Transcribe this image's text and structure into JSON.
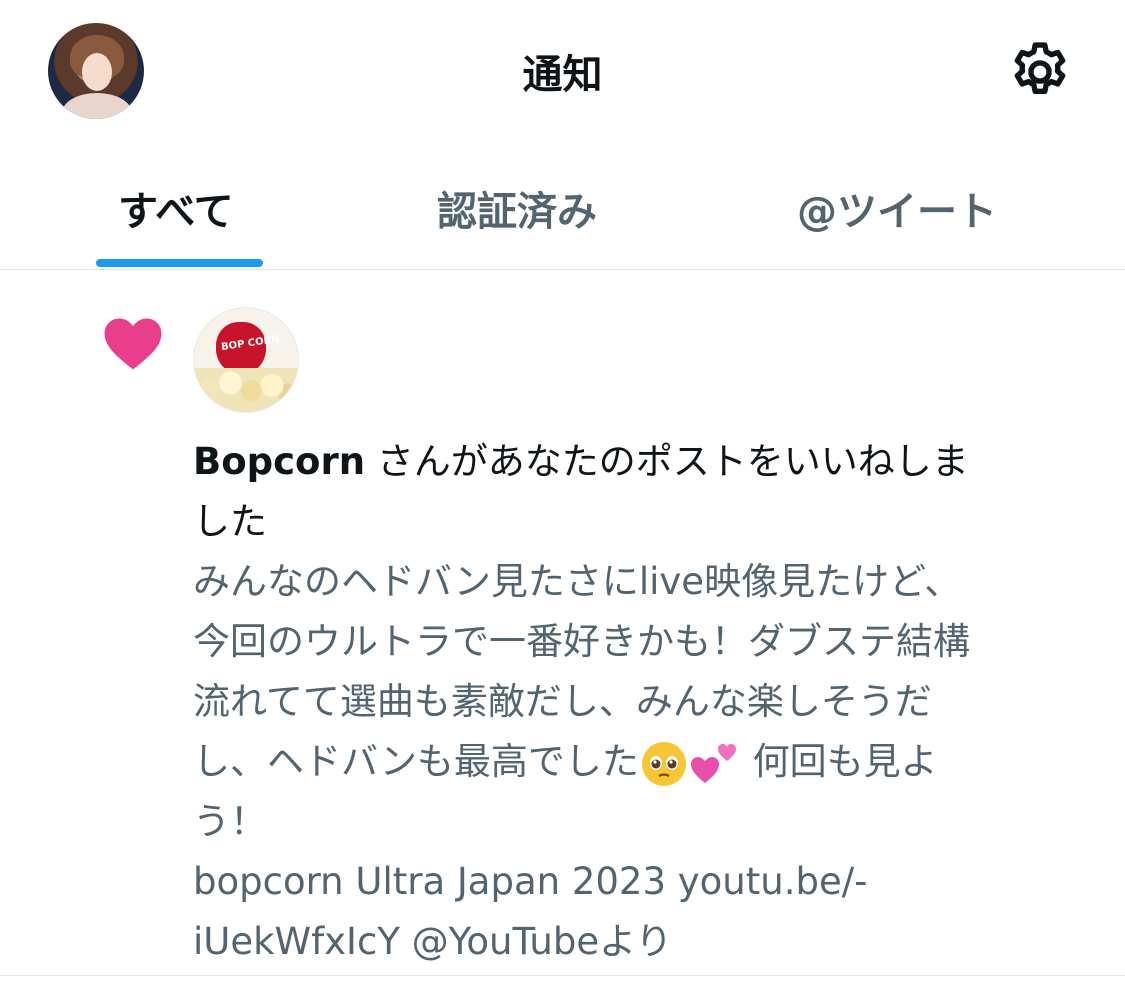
{
  "header": {
    "title": "通知"
  },
  "tabs": [
    {
      "label": "すべて",
      "active": true
    },
    {
      "label": "認証済み",
      "active": false
    },
    {
      "label": "@ツイート",
      "active": false
    }
  ],
  "notification": {
    "actor": "Bopcorn",
    "action_line1": " さんがあなたのポストをいいねしま",
    "action_line2": "した",
    "post_lines": [
      "みんなのヘドバン見たさにlive映像見たけど、",
      "今回のウルトラで一番好きかも！ダブステ結構",
      "流れてて選曲も素敵だし、みんな楽しそうだ",
      "し、ヘドバンも最高でした",
      " 何回も見よ",
      "う！",
      "bopcorn Ultra Japan 2023 youtu.be/-",
      "iUekWfxIcY @YouTubeより"
    ],
    "icons": {
      "type": "heart-icon",
      "emoji1": "pleading-face-emoji",
      "emoji2": "two-hearts-emoji"
    }
  },
  "colors": {
    "accent": "#1d9bf0",
    "heart": "#e83e8c",
    "text_primary": "#0f1419",
    "text_secondary": "#536471"
  },
  "avatar_logo_text": "BOP CORN"
}
